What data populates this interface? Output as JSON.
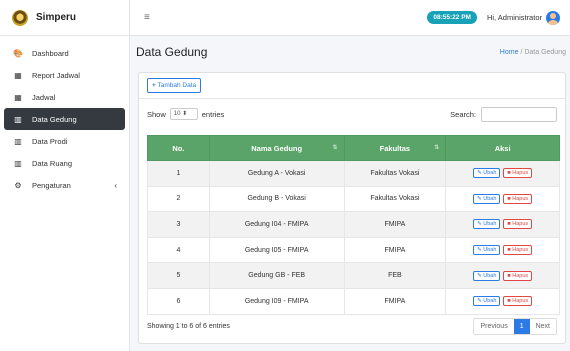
{
  "brand": {
    "name": "Simperu"
  },
  "sidebar": {
    "items": [
      {
        "label": "Dashboard",
        "icon": "palette-icon",
        "glyph": "🎨"
      },
      {
        "label": "Report Jadwal",
        "icon": "calendar-icon",
        "glyph": "▦"
      },
      {
        "label": "Jadwal",
        "icon": "calendar-icon",
        "glyph": "▦"
      },
      {
        "label": "Data Gedung",
        "icon": "building-icon",
        "glyph": "▥",
        "active": true
      },
      {
        "label": "Data Prodi",
        "icon": "building-icon",
        "glyph": "▥"
      },
      {
        "label": "Data Ruang",
        "icon": "building-icon",
        "glyph": "▥"
      },
      {
        "label": "Pengaturan",
        "icon": "cogs-icon",
        "glyph": "⚙",
        "caret": "‹"
      }
    ]
  },
  "topbar": {
    "menu_glyph": "≡",
    "time": "08:55:22 PM",
    "greeting": "Hi, Administrator"
  },
  "header": {
    "title": "Data Gedung",
    "breadcrumb_home": "Home",
    "breadcrumb_sep": "/",
    "breadcrumb_current": "Data Gedung"
  },
  "toolbar": {
    "add_label": "Tambah Data",
    "add_glyph": "+"
  },
  "controls": {
    "show_label": "Show",
    "entries_value": "10",
    "entries_glyph": "⬍",
    "entries_label": "entries",
    "search_label": "Search:"
  },
  "table": {
    "headers": [
      "No.",
      "Nama Gedung",
      "Fakultas",
      "Aksi"
    ],
    "rows": [
      {
        "no": "1",
        "nama": "Gedung A - Vokasi",
        "fakultas": "Fakultas Vokasi"
      },
      {
        "no": "2",
        "nama": "Gedung B - Vokasi",
        "fakultas": "Fakultas Vokasi"
      },
      {
        "no": "3",
        "nama": "Gedung I04 - FMIPA",
        "fakultas": "FMIPA"
      },
      {
        "no": "4",
        "nama": "Gedung I05 - FMIPA",
        "fakultas": "FMIPA"
      },
      {
        "no": "5",
        "nama": "Gedung GB - FEB",
        "fakultas": "FEB"
      },
      {
        "no": "6",
        "nama": "Gedung I09 - FMIPA",
        "fakultas": "FMIPA"
      }
    ],
    "edit_label": "Ubah",
    "edit_glyph": "✎",
    "delete_label": "Hapus",
    "delete_glyph": "■",
    "sort_glyph": "⇅"
  },
  "footer": {
    "info": "Showing 1 to 6 of 6 entries",
    "prev": "Previous",
    "page": "1",
    "next": "Next"
  },
  "colors": {
    "accent": "#2c7be5",
    "header_green": "#5aa469",
    "danger": "#e04848",
    "badge": "#17a2b8",
    "sidebar_active": "#343a40"
  }
}
